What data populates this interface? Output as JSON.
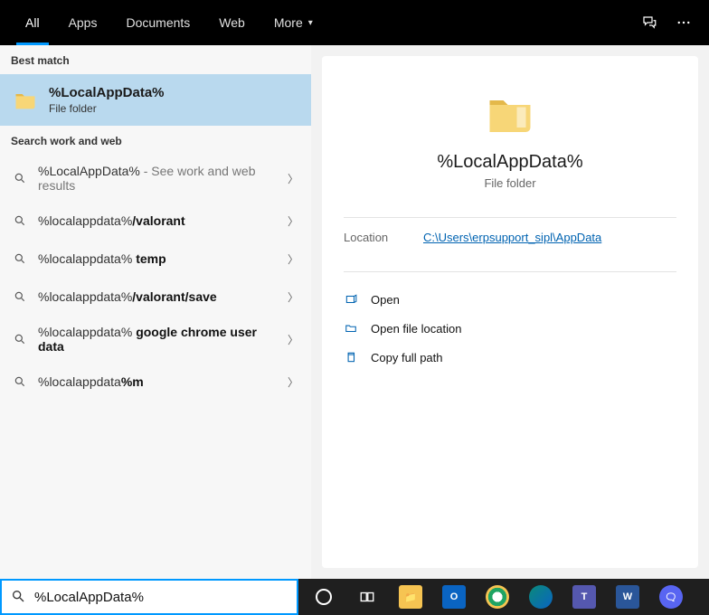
{
  "topbar": {
    "tabs": [
      "All",
      "Apps",
      "Documents",
      "Web",
      "More"
    ]
  },
  "sections": {
    "best_match_label": "Best match",
    "search_web_label": "Search work and web"
  },
  "best_match": {
    "title": "%LocalAppData%",
    "subtitle": "File folder"
  },
  "suggestions": [
    {
      "prefix": "%LocalAppData%",
      "bold": "",
      "hint": " - See work and web results"
    },
    {
      "prefix": "%localappdata%",
      "bold": "/valorant",
      "hint": ""
    },
    {
      "prefix": "%localappdata% ",
      "bold": "temp",
      "hint": ""
    },
    {
      "prefix": "%localappdata%",
      "bold": "/valorant/save",
      "hint": ""
    },
    {
      "prefix": "%localappdata% ",
      "bold": "google chrome user data",
      "hint": ""
    },
    {
      "prefix": "%localappdata",
      "bold": "%m",
      "hint": ""
    }
  ],
  "preview": {
    "title": "%LocalAppData%",
    "subtitle": "File folder",
    "location_label": "Location",
    "location_value": "C:\\Users\\erpsupport_sipl\\AppData",
    "actions": {
      "open": "Open",
      "open_location": "Open file location",
      "copy_path": "Copy full path"
    }
  },
  "search": {
    "value": "%LocalAppData%"
  },
  "taskbar": {
    "items": [
      {
        "name": "cortana",
        "bg": "transparent",
        "glyph": "◯",
        "color": "#fff"
      },
      {
        "name": "taskview",
        "bg": "transparent",
        "glyph": "⧉",
        "color": "#fff"
      },
      {
        "name": "explorer",
        "bg": "#f6c452",
        "glyph": "📁",
        "color": "#fff"
      },
      {
        "name": "outlook",
        "bg": "#0a64c2",
        "glyph": "O",
        "color": "#fff"
      },
      {
        "name": "chrome",
        "bg": "#fff",
        "glyph": "◉",
        "color": "#1fa463"
      },
      {
        "name": "edge",
        "bg": "#0a8a7a",
        "glyph": "e",
        "color": "#fff"
      },
      {
        "name": "teams",
        "bg": "#5558af",
        "glyph": "T",
        "color": "#fff"
      },
      {
        "name": "word",
        "bg": "#2a5699",
        "glyph": "W",
        "color": "#fff"
      },
      {
        "name": "discord",
        "bg": "#5865f2",
        "glyph": "🗨",
        "color": "#fff"
      }
    ]
  }
}
